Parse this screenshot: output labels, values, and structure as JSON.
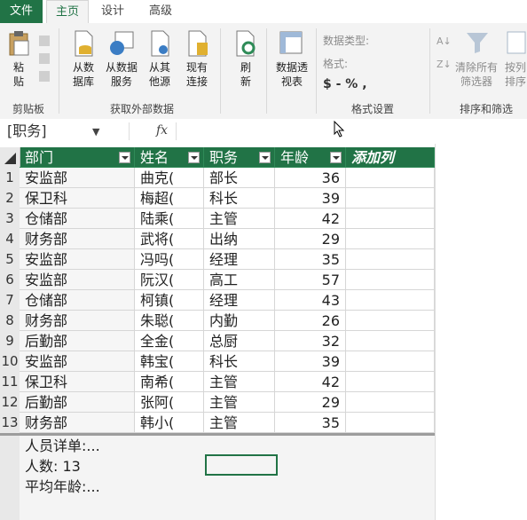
{
  "tabs": [
    "文件",
    "主页",
    "设计",
    "高级"
  ],
  "ribbon": {
    "clipboard": {
      "paste": "粘\n贴",
      "group": "剪贴板"
    },
    "external": {
      "from_db": "从数\n据库",
      "from_service": "从数据\n服务",
      "from_other": "从其\n他源",
      "existing": "现有\n连接",
      "group": "获取外部数据"
    },
    "refresh": "刷\n新",
    "pivot": "数据透\n视表",
    "format": {
      "data_type": "数据类型:",
      "format": "格式:",
      "symbols": "$ - % ,",
      "group": "格式设置"
    },
    "sort": {
      "clear_all": "清除所有\n筛选器",
      "sort_by_col": "按列\n排序",
      "group": "排序和筛选"
    }
  },
  "formula_bar": {
    "name_box": "[职务]",
    "fx": "fx",
    "value": ""
  },
  "table": {
    "headers": [
      "部门",
      "姓名",
      "职务",
      "年龄",
      "添加列"
    ],
    "rows": [
      {
        "n": "1",
        "dept": "安监部",
        "name": "曲克(",
        "title": "部长",
        "age": "36"
      },
      {
        "n": "2",
        "dept": "保卫科",
        "name": "梅超(",
        "title": "科长",
        "age": "39"
      },
      {
        "n": "3",
        "dept": "仓储部",
        "name": "陆乘(",
        "title": "主管",
        "age": "42"
      },
      {
        "n": "4",
        "dept": "财务部",
        "name": "武将(",
        "title": "出纳",
        "age": "29"
      },
      {
        "n": "5",
        "dept": "安监部",
        "name": "冯吗(",
        "title": "经理",
        "age": "35"
      },
      {
        "n": "6",
        "dept": "安监部",
        "name": "阮汉(",
        "title": "高工",
        "age": "57"
      },
      {
        "n": "7",
        "dept": "仓储部",
        "name": "柯镇(",
        "title": "经理",
        "age": "43"
      },
      {
        "n": "8",
        "dept": "财务部",
        "name": "朱聪(",
        "title": "内勤",
        "age": "26"
      },
      {
        "n": "9",
        "dept": "后勤部",
        "name": "全金(",
        "title": "总厨",
        "age": "32"
      },
      {
        "n": "10",
        "dept": "安监部",
        "name": "韩宝(",
        "title": "科长",
        "age": "39"
      },
      {
        "n": "11",
        "dept": "保卫科",
        "name": "南希(",
        "title": "主管",
        "age": "42"
      },
      {
        "n": "12",
        "dept": "后勤部",
        "name": "张阿(",
        "title": "主管",
        "age": "29"
      },
      {
        "n": "13",
        "dept": "财务部",
        "name": "韩小(",
        "title": "主管",
        "age": "35"
      }
    ]
  },
  "summary": {
    "detail": "人员详单:...",
    "count": "人数: 13",
    "avg": "平均年龄:..."
  },
  "colors": {
    "accent": "#217346",
    "header": "#217346"
  }
}
